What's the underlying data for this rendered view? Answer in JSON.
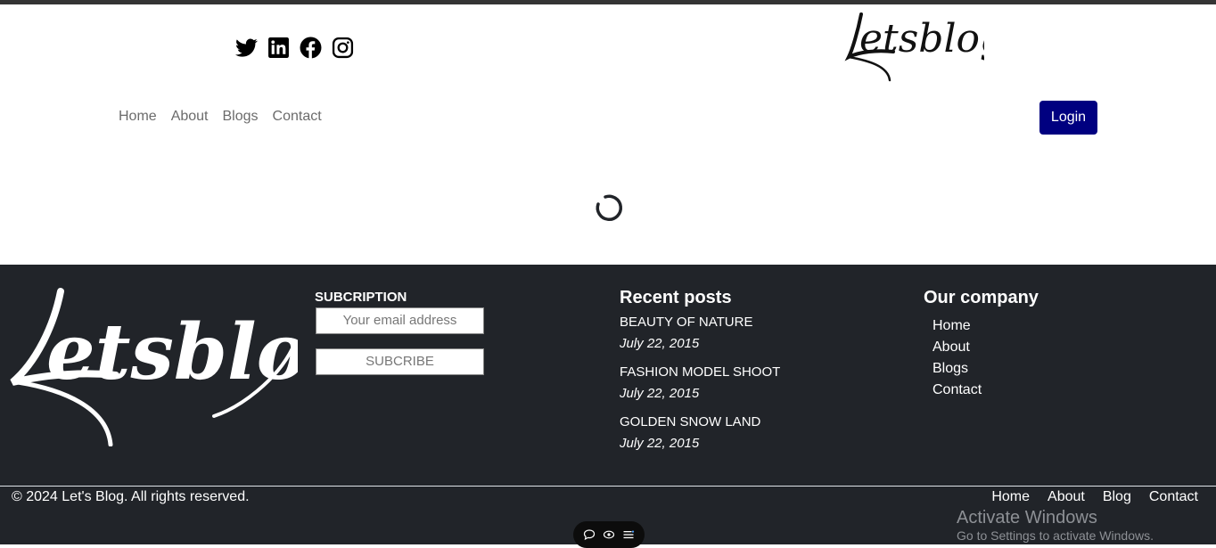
{
  "header": {
    "social_icons": [
      "twitter-icon",
      "linkedin-icon",
      "facebook-icon",
      "instagram-icon"
    ],
    "logo_text": "Letsblog",
    "nav": [
      "Home",
      "About",
      "Blogs",
      "Contact"
    ],
    "login_label": "Login"
  },
  "footer": {
    "logo_text": "Letsblog",
    "subscription_title": "SUBCRIPTION",
    "email_placeholder": "Your email address",
    "subscribe_label": "SUBCRIBE",
    "recent_title": "Recent posts",
    "posts": [
      {
        "title": "BEAUTY OF NATURE",
        "date": "July 22, 2015"
      },
      {
        "title": "FASHION MODEL SHOOT",
        "date": "July 22, 2015"
      },
      {
        "title": "GOLDEN SNOW LAND",
        "date": "July 22, 2015"
      }
    ],
    "company_title": "Our company",
    "company_links": [
      "Home",
      "About",
      "Blogs",
      "Contact"
    ],
    "copyright": "© 2024 Let's Blog. All rights reserved.",
    "bottom_links": [
      "Home",
      "About",
      "Blog",
      "Contact"
    ]
  },
  "overlay": {
    "activate_title": "Activate Windows",
    "activate_sub": "Go to Settings to activate Windows."
  },
  "colors": {
    "login_bg": "#000080",
    "footer_bg": "#212429"
  }
}
